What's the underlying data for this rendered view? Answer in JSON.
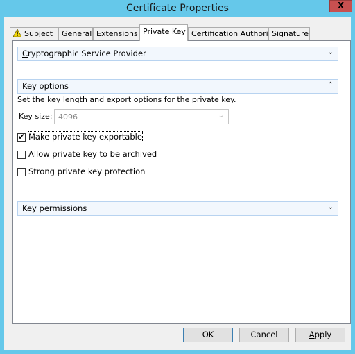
{
  "window": {
    "title": "Certificate Properties",
    "close_label": "X"
  },
  "tabs": [
    {
      "label": "Subject",
      "icon": "warning-icon"
    },
    {
      "label": "General"
    },
    {
      "label": "Extensions"
    },
    {
      "label": "Private Key",
      "active": true
    },
    {
      "label": "Certification Authority"
    },
    {
      "label": "Signature"
    }
  ],
  "sections": {
    "csp": {
      "label_pre": "",
      "label_key": "C",
      "label_post": "ryptographic Service Provider",
      "expanded": false
    },
    "key_options": {
      "label_pre": "Key ",
      "label_key": "o",
      "label_post": "ptions",
      "expanded": true
    },
    "key_permissions": {
      "label_pre": "Key ",
      "label_key": "p",
      "label_post": "ermissions",
      "expanded": false
    }
  },
  "key_options": {
    "description": "Set the key length and export options for the private key.",
    "key_size_label": "Key size:",
    "key_size_value": "4096",
    "checkboxes": [
      {
        "label": "Make private key exportable",
        "checked": true
      },
      {
        "label": "Allow private key to be archived",
        "checked": false
      },
      {
        "label": "Strong private key protection",
        "checked": false
      }
    ]
  },
  "buttons": {
    "ok": "OK",
    "cancel": "Cancel",
    "apply_key": "A",
    "apply_rest": "pply"
  }
}
